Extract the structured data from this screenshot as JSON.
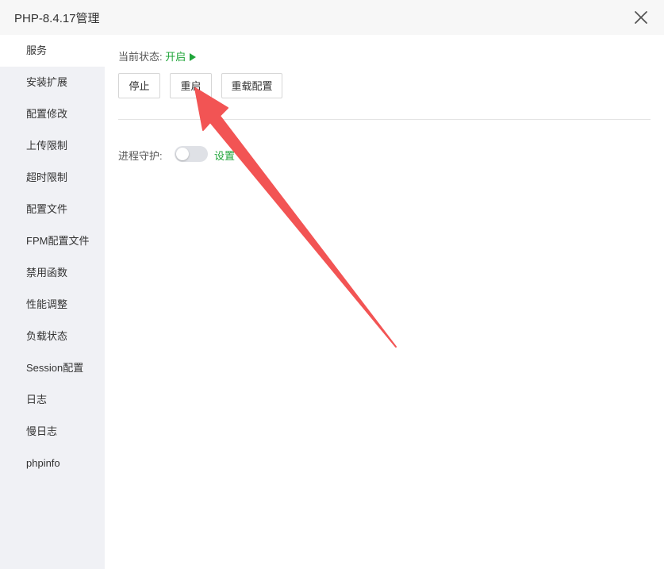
{
  "window": {
    "title": "PHP-8.4.17管理"
  },
  "sidebar": {
    "items": [
      {
        "label": "服务",
        "active": true
      },
      {
        "label": "安装扩展"
      },
      {
        "label": "配置修改"
      },
      {
        "label": "上传限制"
      },
      {
        "label": "超时限制"
      },
      {
        "label": "配置文件"
      },
      {
        "label": "FPM配置文件"
      },
      {
        "label": "禁用函数"
      },
      {
        "label": "性能调整"
      },
      {
        "label": "负载状态"
      },
      {
        "label": "Session配置"
      },
      {
        "label": "日志"
      },
      {
        "label": "慢日志"
      },
      {
        "label": "phpinfo"
      }
    ]
  },
  "service": {
    "status_label": "当前状态:",
    "status_value": "开启",
    "buttons": {
      "stop": "停止",
      "restart": "重启",
      "reload": "重载配置"
    },
    "guard_label": "进程守护:",
    "guard_enabled": false,
    "setting_link": "设置"
  },
  "colors": {
    "accent_green": "#20a53a",
    "sidebar_bg": "#f0f1f5",
    "annotation_arrow": "#f25454"
  }
}
